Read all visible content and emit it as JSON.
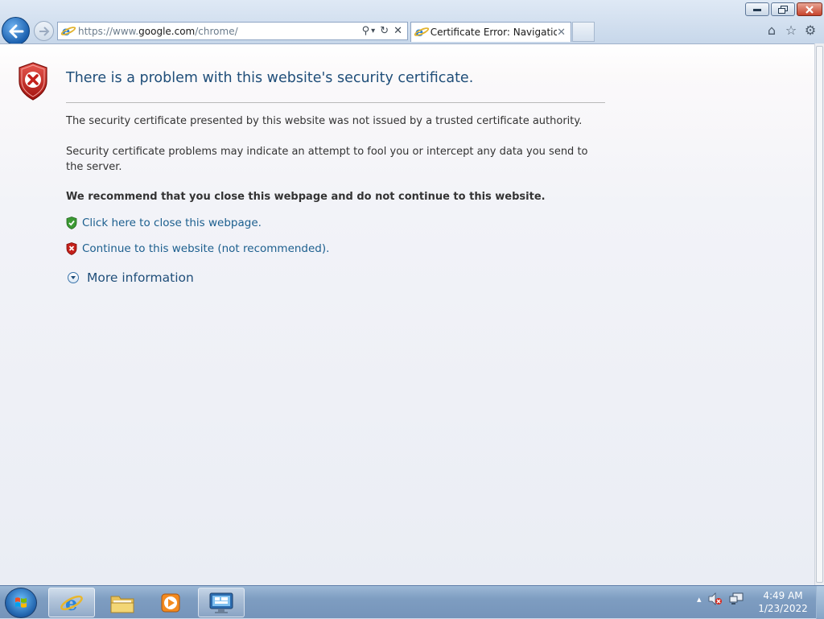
{
  "window": {
    "minimize_label": "0",
    "maximize_label": "1",
    "close_label": "r"
  },
  "toolbar": {
    "url_prefix": "https://www.",
    "url_host": "google.com",
    "url_path": "/chrome/",
    "search_glyph": "⚲",
    "dropdown_glyph": "▾",
    "refresh_glyph": "↻",
    "stop_glyph": "✕",
    "tab_title": "Certificate Error: Navigatio...",
    "tab_close_glyph": "✕",
    "home_glyph": "⌂",
    "favorites_glyph": "☆",
    "tools_glyph": "⚙"
  },
  "page": {
    "heading": "There is a problem with this website's security certificate.",
    "para1": "The security certificate presented by this website was not issued by a trusted certificate authority.",
    "para2": "Security certificate problems may indicate an attempt to fool you or intercept any data you send to the server.",
    "recommend": "We recommend that you close this webpage and do not continue to this website.",
    "link_close": "Click here to close this webpage.",
    "link_continue": "Continue to this website (not recommended).",
    "more_info": "More information"
  },
  "colors": {
    "heading": "#1f4e79",
    "link": "#1b5e8e",
    "shield_red": "#c4201b",
    "shield_green": "#3c9a34"
  },
  "taskbar": {
    "pinned": [
      "internet-explorer-icon",
      "windows-explorer-icon",
      "media-player-icon",
      "remote-desktop-icon"
    ],
    "tray_up_glyph": "▴",
    "clock_time": "4:49 AM",
    "clock_date": "1/23/2022"
  }
}
